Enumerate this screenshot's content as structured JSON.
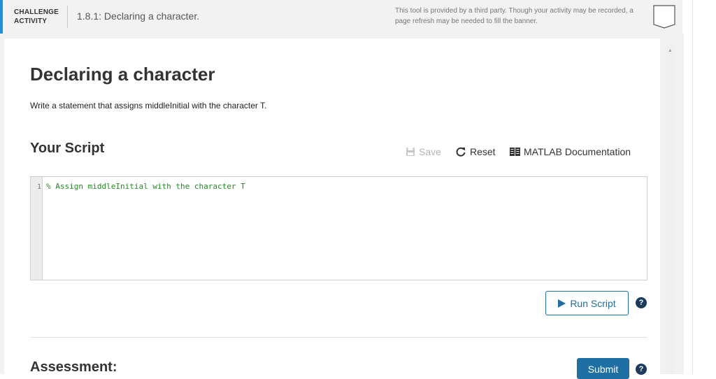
{
  "banner": {
    "challenge_line1": "CHALLENGE",
    "challenge_line2": "ACTIVITY",
    "title": "1.8.1: Declaring a character.",
    "third_party_notice": "This tool is provided by a third party. Though your activity may be recorded, a page refresh may be needed to fill the banner.",
    "accent_color": "#1e8fd6",
    "bookmark_icon": "bookmark-icon"
  },
  "main": {
    "heading": "Declaring a character",
    "instructions": "Write a statement that assigns middleInitial with the character T.",
    "script_heading": "Your Script",
    "toolbar": {
      "save_label": "Save",
      "reset_label": "Reset",
      "docs_label": "MATLAB Documentation",
      "save_icon": "floppy-disk-icon",
      "reset_icon": "reset-arrow-icon",
      "docs_icon": "book-icon"
    },
    "editor": {
      "line_number": "1",
      "code": "% Assign middleInitial with the character T",
      "comment_color": "#228b22"
    },
    "run_button_label": "Run Script",
    "help_symbol": "?",
    "assessment_heading": "Assessment:",
    "submit_label": "Submit",
    "primary_color": "#1e6fa3"
  }
}
